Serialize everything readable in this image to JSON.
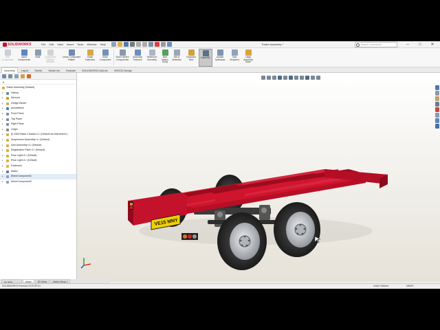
{
  "app": {
    "brand": "SOLIDWORKS",
    "document_title": "Trailer Assembly *",
    "menus": [
      "File",
      "Edit",
      "View",
      "Insert",
      "Tools",
      "Window",
      "Help"
    ],
    "search_placeholder": "Search Commands",
    "window_controls": [
      "–",
      "□",
      "✕"
    ]
  },
  "ribbon": {
    "buttons": [
      {
        "label": "Edit Component",
        "icon": "edit-component-icon",
        "disabled": true
      },
      {
        "label": "Insert Components",
        "icon": "insert-components-icon"
      },
      {
        "label": "Mate",
        "icon": "mate-icon"
      },
      {
        "label": "Component Preview Window",
        "icon": "component-preview-icon",
        "disabled": true
      },
      {
        "label": "Linear Component Pattern",
        "icon": "linear-pattern-icon"
      },
      {
        "label": "Smart Fasteners",
        "icon": "smart-fasteners-icon"
      },
      {
        "label": "Move Component",
        "icon": "move-component-icon"
      },
      {
        "label": "Show Hidden Components",
        "icon": "show-hidden-icon"
      },
      {
        "label": "Assembly Features",
        "icon": "assembly-features-icon"
      },
      {
        "label": "Reference Geometry",
        "icon": "reference-geometry-icon"
      },
      {
        "label": "New Motion Study",
        "icon": "motion-study-icon"
      },
      {
        "label": "Bill of Materials",
        "icon": "bom-icon"
      },
      {
        "label": "Exploded View",
        "icon": "exploded-view-icon"
      },
      {
        "label": "Instant3D",
        "icon": "instant3d-icon",
        "active": true
      },
      {
        "label": "Update Speedpak",
        "icon": "speedpak-icon"
      },
      {
        "label": "Take Snapshot",
        "icon": "snapshot-icon"
      },
      {
        "label": "Large Assembly Mode",
        "icon": "large-assembly-icon"
      }
    ]
  },
  "command_tabs": [
    "Assembly",
    "Layout",
    "Sketch",
    "Sketch Ink",
    "Evaluate",
    "SOLIDWORKS Add-Ins",
    "SWOOD Design"
  ],
  "feature_tree": {
    "root": "Trailer Assembly  (Default)",
    "items": [
      {
        "label": "History",
        "icon": "history-icon",
        "color": "#6a87a8"
      },
      {
        "label": "Sensors",
        "icon": "sensors-icon",
        "color": "#d0a000"
      },
      {
        "label": "Design Binder",
        "icon": "design-binder-icon",
        "color": "#d0b060"
      },
      {
        "label": "Annotations",
        "icon": "annotations-icon",
        "color": "#4a7abf"
      },
      {
        "label": "Front Plane",
        "icon": "plane-icon",
        "color": "#7a8ea8"
      },
      {
        "label": "Top Plane",
        "icon": "plane-icon",
        "color": "#7a8ea8"
      },
      {
        "label": "Right Plane",
        "icon": "plane-icon",
        "color": "#7a8ea8"
      },
      {
        "label": "Origin",
        "icon": "origin-icon",
        "color": "#888888"
      },
      {
        "label": "(f) 1500 Basic Chassis<1> (Default<As Machined>)",
        "icon": "part-icon",
        "color": "#d8b040"
      },
      {
        "label": "Suspension Assembly<1> (Default)",
        "icon": "assembly-icon",
        "color": "#d8b040"
      },
      {
        "label": "Axle Assembly<1> (Default)",
        "icon": "assembly-icon",
        "color": "#d8b040"
      },
      {
        "label": "Registration Plate<1> (Default)",
        "icon": "part-icon",
        "color": "#d8b040"
      },
      {
        "label": "Rear Light<1> (Default)",
        "icon": "part-icon",
        "color": "#d8b040"
      },
      {
        "label": "Rear Light<1> (Default)",
        "icon": "part-icon",
        "color": "#d8b040"
      },
      {
        "label": "Fasteners",
        "icon": "folder-icon",
        "color": "#e0b040"
      },
      {
        "label": "Mates",
        "icon": "mates-icon",
        "color": "#6a7a90"
      },
      {
        "label": "MirrorComponent1",
        "icon": "mirror-icon",
        "color": "#8aa0b8"
      },
      {
        "label": "MirrorComponent2",
        "icon": "mirror-icon",
        "color": "#8aa0b8"
      }
    ]
  },
  "bottom_tabs": [
    "Model",
    "3D Views",
    "Motion Study 1"
  ],
  "status": {
    "left": "SOLIDWORKS Premium 2019 SP3.0",
    "state": "Under Defined",
    "units": "MMGS"
  },
  "model": {
    "plate_text": "VE15 MNY",
    "frame_color": "#c8102e",
    "tire_color": "#2a2a2a",
    "rim_color": "#c4c8cc"
  },
  "colors": {
    "accent": "#c8102e",
    "viewport_top": "#ffffff",
    "viewport_bottom": "#e6e2d8"
  }
}
